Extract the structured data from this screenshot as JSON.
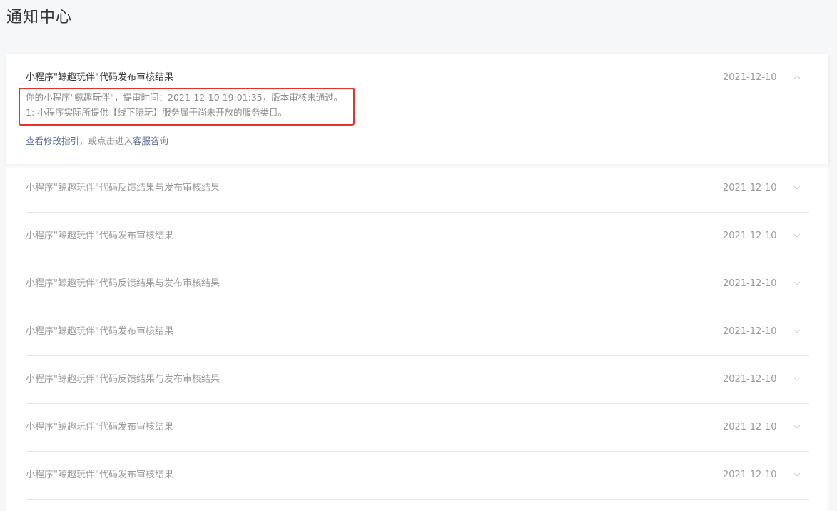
{
  "page": {
    "title": "通知中心"
  },
  "expanded_item": {
    "title": "小程序\"鲸趣玩伴\"代码发布审核结果",
    "date": "2021-12-10",
    "detail_line1": "你的小程序\"鲸趣玩伴\"，提审时间：2021-12-10 19:01:35，版本审核未通过。",
    "detail_line2": "1: 小程序实际所提供【线下陪玩】服务属于尚未开放的服务类目。",
    "guide_link": "查看修改指引",
    "guide_middle": "，或点击进入",
    "service_link": "客服咨询",
    "arrow_icon": "chevron-up-icon"
  },
  "items": [
    {
      "title": "小程序\"鲸趣玩伴\"代码反馈结果与发布审核结果",
      "date": "2021-12-10"
    },
    {
      "title": "小程序\"鲸趣玩伴\"代码发布审核结果",
      "date": "2021-12-10"
    },
    {
      "title": "小程序\"鲸趣玩伴\"代码反馈结果与发布审核结果",
      "date": "2021-12-10"
    },
    {
      "title": "小程序\"鲸趣玩伴\"代码发布审核结果",
      "date": "2021-12-10"
    },
    {
      "title": "小程序\"鲸趣玩伴\"代码反馈结果与发布审核结果",
      "date": "2021-12-10"
    },
    {
      "title": "小程序\"鲸趣玩伴\"代码发布审核结果",
      "date": "2021-12-10"
    },
    {
      "title": "小程序\"鲸趣玩伴\"代码发布审核结果",
      "date": "2021-12-10"
    }
  ],
  "colors": {
    "link": "#576b95",
    "highlight": "#e6322b"
  }
}
